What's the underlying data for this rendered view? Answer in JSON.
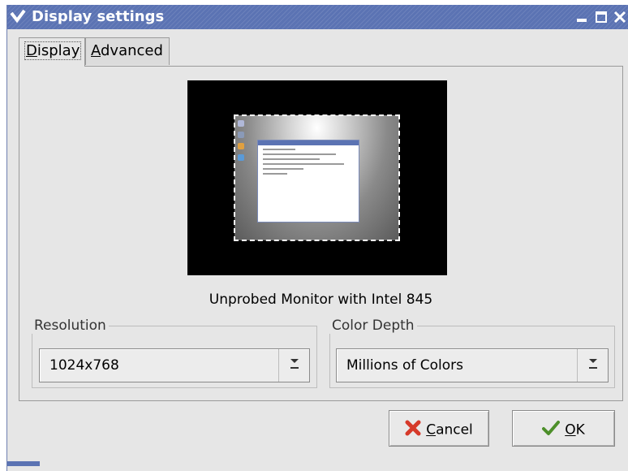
{
  "window": {
    "title": "Display settings",
    "controls": [
      "minimize-icon",
      "maximize-icon",
      "close-icon"
    ]
  },
  "tabs": [
    {
      "label_mnemonic": "D",
      "label_rest": "isplay",
      "active": true
    },
    {
      "label_mnemonic": "A",
      "label_rest": "dvanced",
      "active": false
    }
  ],
  "monitor": {
    "label": "Unprobed Monitor with Intel 845"
  },
  "resolution": {
    "legend": "Resolution",
    "value": "1024x768"
  },
  "color_depth": {
    "legend": "Color Depth",
    "value": "Millions of Colors"
  },
  "buttons": {
    "cancel_mnemonic": "C",
    "cancel_rest": "ancel",
    "ok_mnemonic": "O",
    "ok_rest": "K"
  },
  "colors": {
    "titlebar": "#5b73b3",
    "window_bg": "#e6e6e6",
    "cancel_icon": "#d63a2a",
    "ok_icon": "#4d8f2a"
  }
}
